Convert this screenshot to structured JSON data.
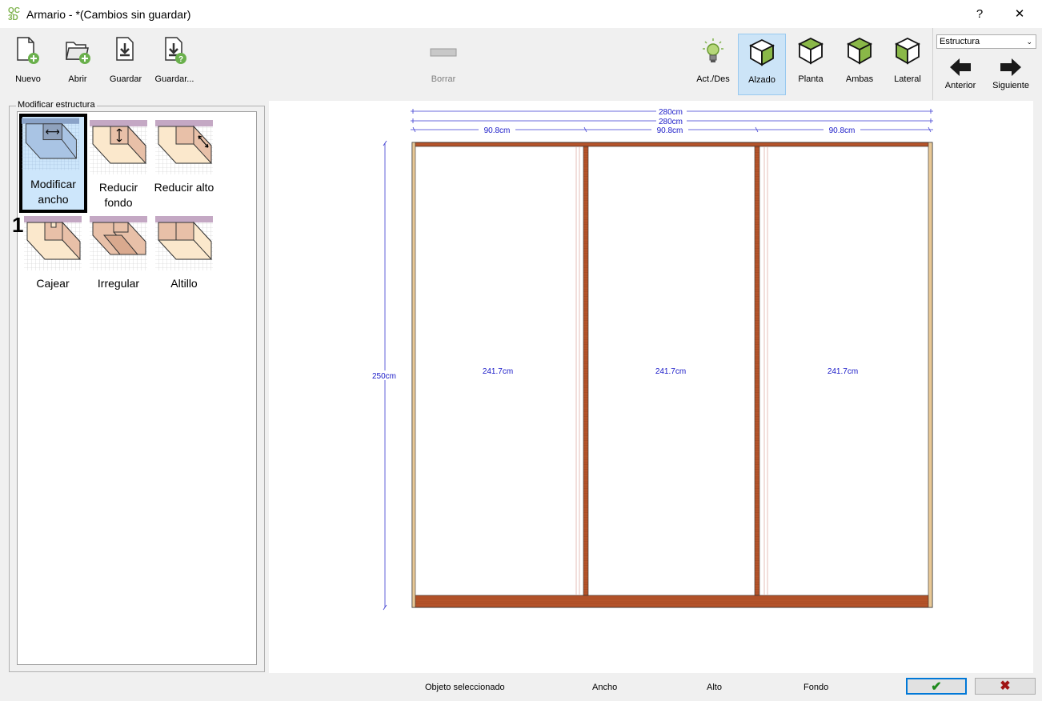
{
  "window": {
    "title": "Armario -  *(Cambios sin guardar)",
    "logo_text": "QC 3D",
    "help_label": "?",
    "close_label": "✕"
  },
  "toolbar": {
    "new_label": "Nuevo",
    "open_label": "Abrir",
    "save_label": "Guardar",
    "save_as_label": "Guardar...",
    "delete_label": "Borrar",
    "toggle_label": "Act./Des",
    "view_elevation_label": "Alzado",
    "view_plan_label": "Planta",
    "view_both_label": "Ambas",
    "view_side_label": "Lateral",
    "prev_label": "Anterior",
    "next_label": "Siguiente",
    "mode_select": "Estructura"
  },
  "panel": {
    "title": "Modificar estructura",
    "step_number": "1",
    "buttons": [
      {
        "label": "Modificar ancho"
      },
      {
        "label": "Reducir fondo"
      },
      {
        "label": "Reducir alto"
      },
      {
        "label": "Cajear"
      },
      {
        "label": "Irregular"
      },
      {
        "label": "Altillo"
      }
    ]
  },
  "drawing": {
    "total_width_1": "280cm",
    "total_width_2": "280cm",
    "module_widths": [
      "90.8cm",
      "90.8cm",
      "90.8cm"
    ],
    "height": "250cm",
    "module_heights": [
      "241.7cm",
      "241.7cm",
      "241.7cm"
    ]
  },
  "status": {
    "selected_object": "Objeto seleccionado",
    "width": "Ancho",
    "height": "Alto",
    "depth": "Fondo"
  },
  "dialog": {
    "ok_glyph": "✔",
    "cancel_glyph": "✖"
  },
  "colors": {
    "accent": "#0078d7",
    "wood": "#b5542a",
    "dimension": "#1a1ac8",
    "active_view_bg": "#cce4f7"
  }
}
